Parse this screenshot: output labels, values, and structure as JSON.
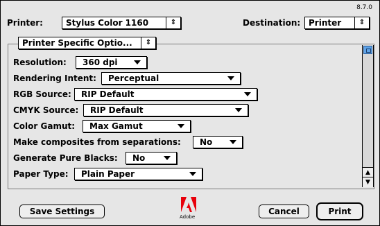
{
  "version": "8.7.0",
  "printer": {
    "label": "Printer:",
    "value": "Stylus Color 1160"
  },
  "destination": {
    "label": "Destination:",
    "value": "Printer"
  },
  "panel": {
    "value": "Printer Specific Optio..."
  },
  "settings": [
    {
      "label": "Resolution:",
      "value": "360 dpi"
    },
    {
      "label": "Rendering Intent:",
      "value": "Perceptual"
    },
    {
      "label": "RGB Source:",
      "value": "RIP Default"
    },
    {
      "label": "CMYK Source:",
      "value": "RIP Default"
    },
    {
      "label": "Color Gamut:",
      "value": "Max Gamut"
    },
    {
      "label": "Make composites from separations:",
      "value": "No"
    },
    {
      "label": "Generate Pure Blacks:",
      "value": "No"
    },
    {
      "label": "Paper Type:",
      "value": "Plain Paper"
    }
  ],
  "buttons": {
    "save": "Save Settings",
    "cancel": "Cancel",
    "print": "Print"
  },
  "logo": {
    "text": "Adobe",
    "icon": "adobe-logo-icon",
    "color": "#e8000b"
  }
}
